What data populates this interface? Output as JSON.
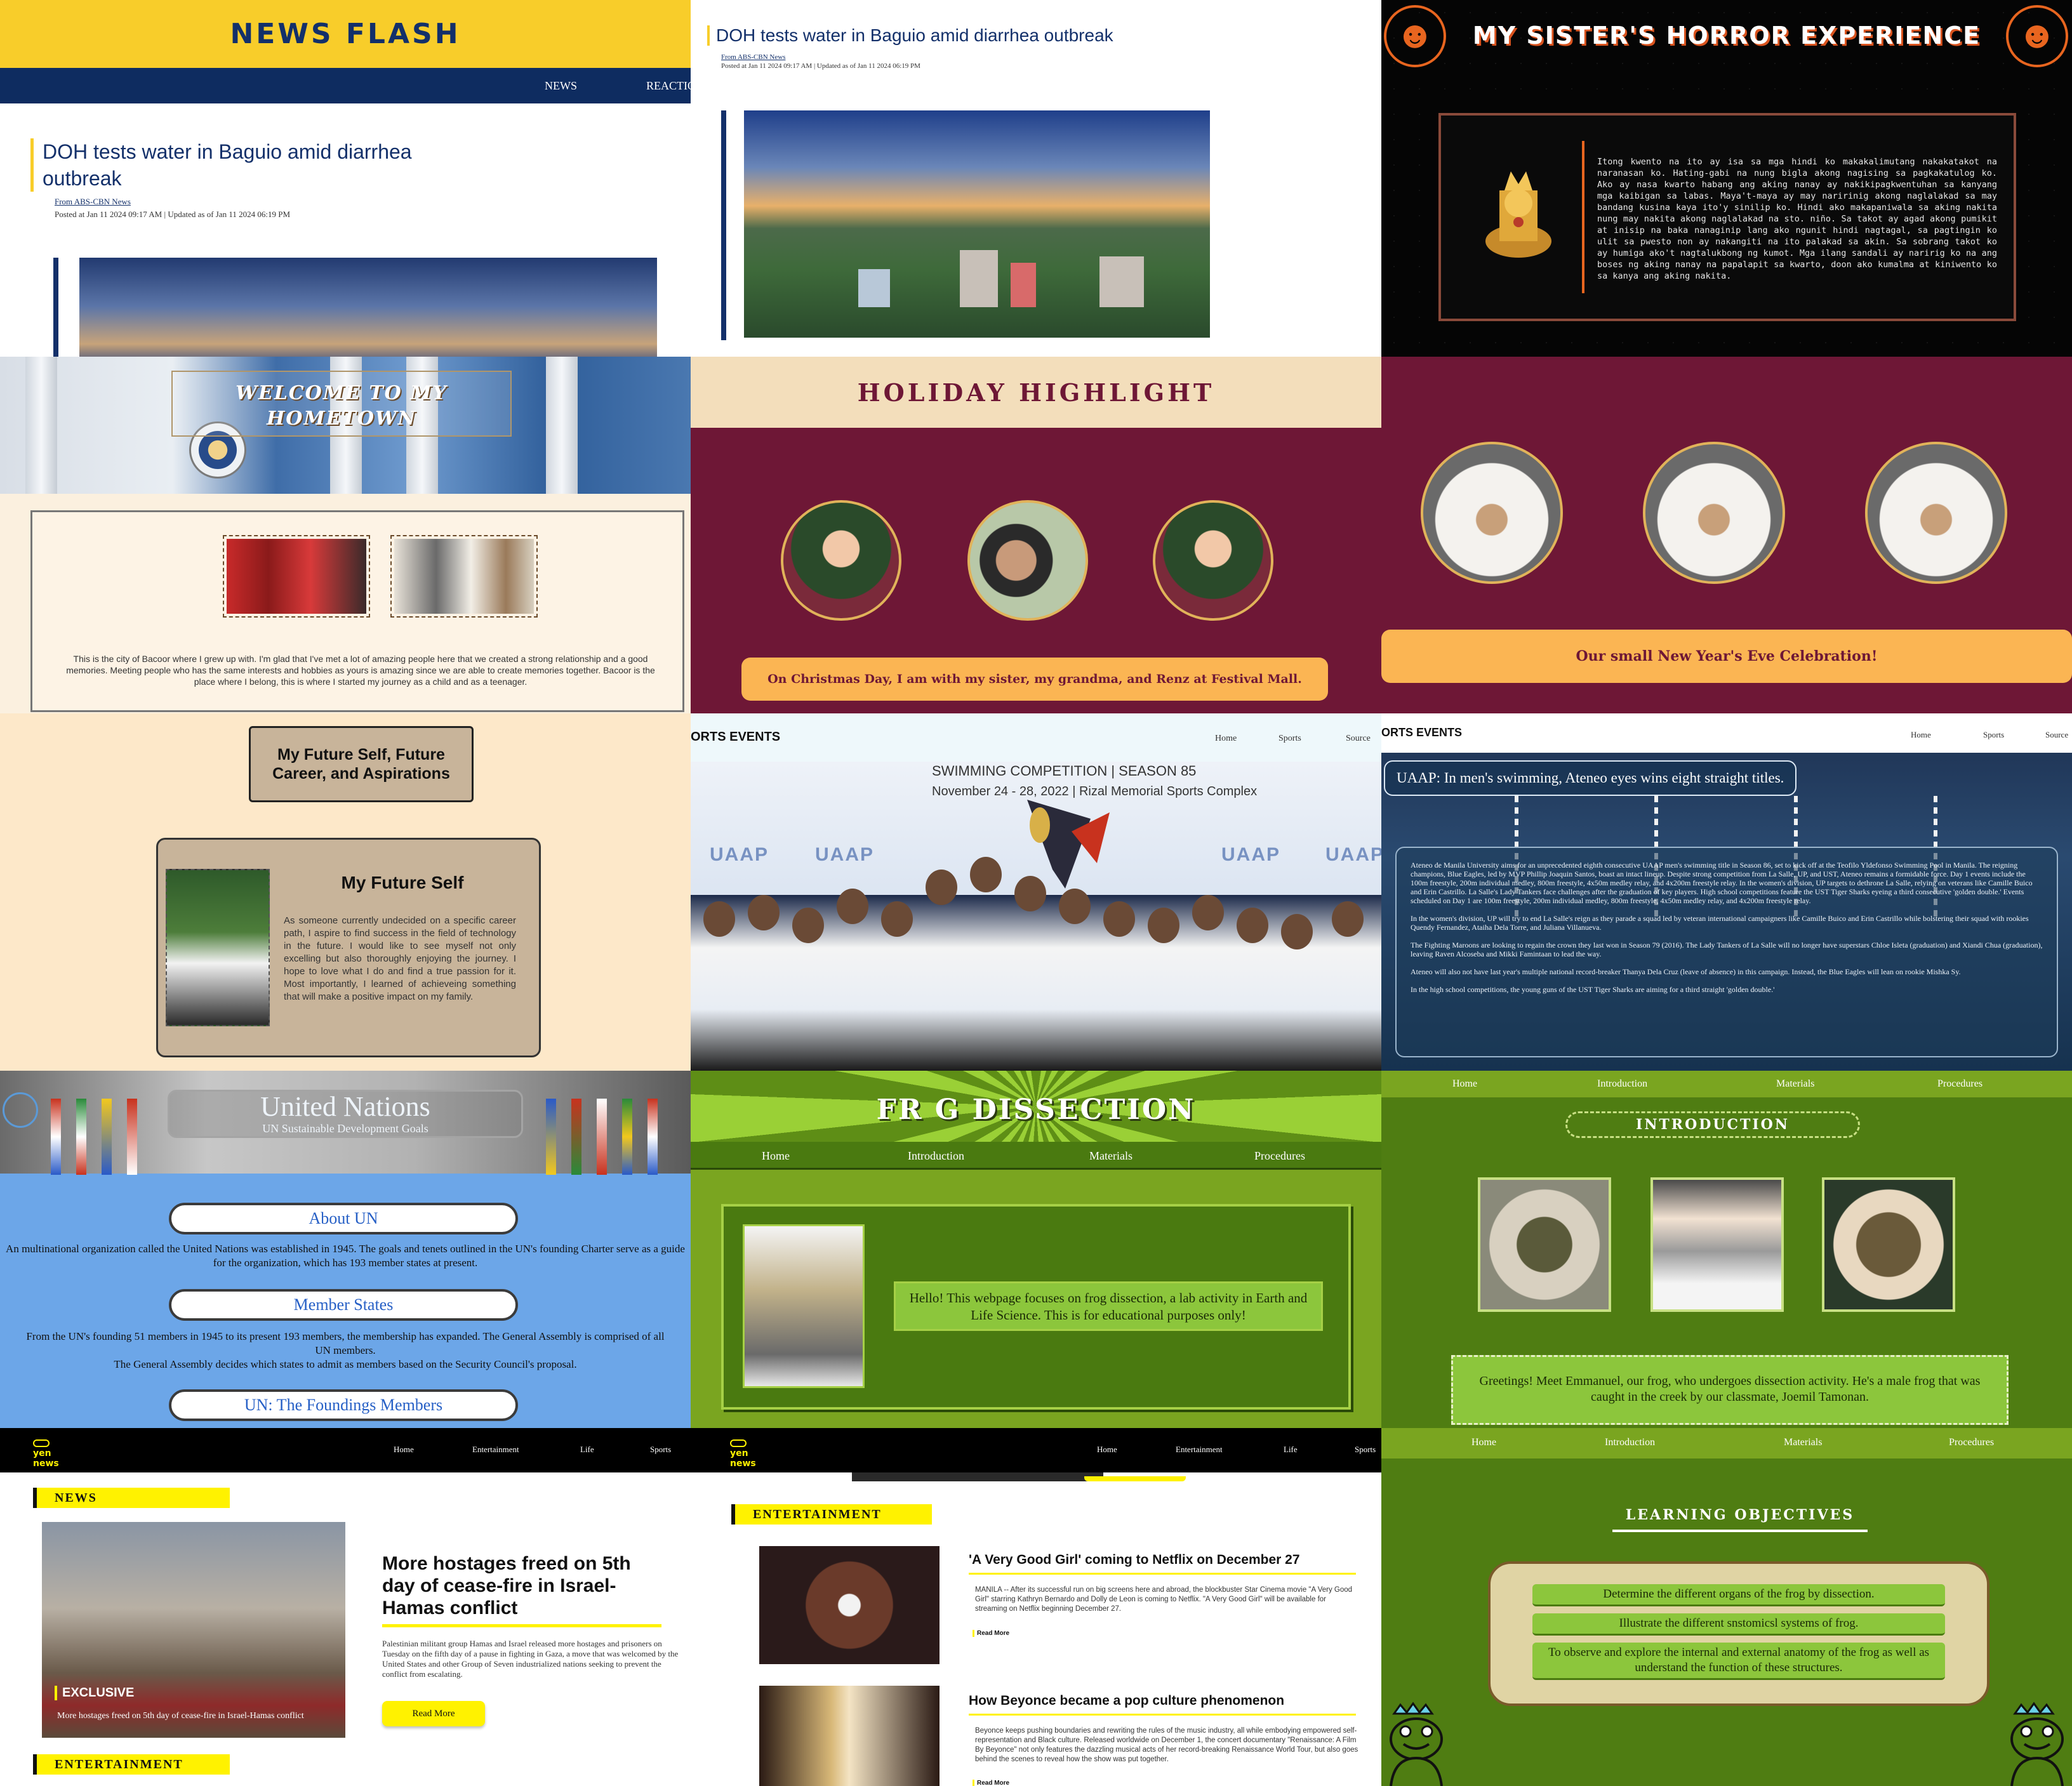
{
  "tile1": {
    "banner": "NEWS FLASH",
    "nav": [
      "NEWS",
      "REACTION"
    ],
    "headline": "DOH tests water in Baguio amid diarrhea outbreak",
    "source": "From ABS-CBN News",
    "posted": "Posted at Jan 11 2024 09:17 AM | Updated as of Jan 11 2024 06:19 PM"
  },
  "tile2": {
    "headline": "DOH tests water in Baguio amid diarrhea outbreak",
    "source": "From ABS-CBN News",
    "posted": "Posted at Jan 11 2024 09:17 AM | Updated as of Jan 11 2024 06:19 PM"
  },
  "tile3": {
    "title": "MY SISTER'S HORROR EXPERIENCE",
    "story": "Itong kwento na ito ay isa sa mga hindi ko makakalimutang nakakatakot na naranasan ko. Hating-gabi na nung bigla akong nagising sa pagkakatulog ko. Ako ay nasa kwarto habang ang aking nanay ay nakikipagkwentuhan sa kanyang mga kaibigan sa labas. Maya't-maya ay may naririnig akong naglalakad sa may bandang kusina kaya ito'y sinilip ko. Hindi ako makapaniwala sa aking nakita nung may nakita akong naglalakad na sto. niño. Sa takot ay agad akong pumikit at inisip na baka nanaginip lang ako ngunit hindi nagtagal, sa pagtingin ko ulit sa pwesto non ay nakangiti na ito palakad sa akin. Sa sobrang takot ko ay humiga ako't nagtalukbong ng kumot. Mga ilang sandali ay naririg ko na ang boses ng aking nanay na papalapit sa kwarto, doon ako kumalma at kiniwento ko sa kanya ang aking nakita."
  },
  "tile4": {
    "title": "WELCOME TO MY HOMETOWN",
    "paragraph": "This is the city of Bacoor where I grew up with. I'm glad that I've met a lot of amazing people here that we created a strong relationship and a good memories. Meeting people who has the same interests and hobbies as yours is amazing since we are able to create memories together. Bacoor is the place where I belong, this is where I started my journey as a child and as a teenager."
  },
  "tile5": {
    "title": "HOLIDAY HIGHLIGHT",
    "caption": "On Christmas Day, I am with my sister, my grandma, and Renz at Festival Mall."
  },
  "tile6": {
    "caption": "Our small New Year's Eve Celebration!"
  },
  "tile7": {
    "title": "My Future Self, Future Career, and Aspirations",
    "card_title": "My Future Self",
    "card_text": "As someone currently undecided on a specific career path, I aspire to find success in the field of technology in the future. I would like to see myself not only excelling but also thoroughly enjoying the journey. I hope to love what I do and find a true passion for it. Most importantly, I learned of achieveing something that will make a positive impact on my family."
  },
  "tile8": {
    "brand": "ORTS EVENTS",
    "nav": [
      "Home",
      "Sports",
      "Source"
    ],
    "event_title": "SWIMMING COMPETITION | SEASON 85",
    "event_sub": "November 24 - 28, 2022 | Rizal Memorial Sports Complex",
    "logo": "UAAP"
  },
  "tile9": {
    "brand": "ORTS EVENTS",
    "nav": [
      "Home",
      "Sports",
      "Source"
    ],
    "headline": "UAAP: In men's swimming, Ateneo eyes wins eight straight titles.",
    "paragraphs": [
      "Ateneo de Manila University aims for an unprecedented eighth consecutive UAAP men's swimming title in Season 86, set to kick off at the Teofilo Yldefonso Swimming Pool in Manila. The reigning champions, Blue Eagles, led by MVP Phillip Joaquin Santos, boast an intact lineup. Despite strong competition from La Salle, UP, and UST, Ateneo remains a formidable force. Day 1 events include the 100m freestyle, 200m individual medley, 800m freestyle, 4x50m medley relay, and 4x200m freestyle relay. In the women's division, UP targets to dethrone La Salle, relying on veterans like Camille Buico and Erin Castrillo. La Salle's Lady Tankers face challenges after the graduation of key players. High school competitions feature the UST Tiger Sharks eyeing a third consecutive 'golden double.' Events scheduled on Day 1 are 100m freestyle, 200m individual medley, 800m freestyle, 4x50m medley relay, and 4x200m freestyle relay.",
      "In the women's division, UP will try to end La Salle's reign as they parade a squad led by veteran international campaigners like Camille Buico and Erin Castrillo while bolstering their squad with rookies Quendy Fernandez, Ataiha Dela Torre, and Juliana Villanueva.",
      "The Fighting Maroons are looking to regain the crown they last won in Season 79 (2016). The Lady Tankers of La Salle will no longer have superstars Chloe Isleta (graduation) and Xiandi Chua (graduation), leaving Raven Alcoseba and Mikki Famintaan to lead the way.",
      "Ateneo will also not have last year's multiple national record-breaker Thanya Dela Cruz (leave of absence) in this campaign. Instead, the Blue Eagles will lean on rookie Mishka Sy.",
      "In the high school competitions, the young guns of the UST Tiger Sharks are aiming for a third straight 'golden double.'"
    ]
  },
  "tile10": {
    "title": "United Nations",
    "subtitle": "UN Sustainable Development Goals",
    "sections": [
      {
        "label": "About UN",
        "text": "An multinational organization called the United Nations was established in 1945. The goals and tenets outlined in the UN's founding Charter serve as a guide for the organization, which has 193 member states at present."
      },
      {
        "label": "Member States",
        "text": "From the UN's founding 51 members in 1945 to its present 193 members, the membership has expanded. The General Assembly is comprised of all UN members.",
        "text2": "The General Assembly decides which states to admit as members based on the Security Council's proposal."
      },
      {
        "label": "UN: The Foundings Members"
      }
    ]
  },
  "tile11": {
    "title": "FR G DISSECTION",
    "nav": [
      "Home",
      "Introduction",
      "Materials",
      "Procedures"
    ],
    "message": "Hello! This webpage focuses on frog dissection, a lab activity in Earth and Life Science. This is for educational purposes only!"
  },
  "tile12": {
    "nav": [
      "Home",
      "Introduction",
      "Materials",
      "Procedures"
    ],
    "heading": "INTRODUCTION",
    "greeting": "Greetings! Meet Emmanuel, our frog, who undergoes dissection activity. He's a male frog that was caught in the creek by our classmate, Joemil Tamonan."
  },
  "tile13": {
    "brand": "yen news",
    "nav": [
      "Home",
      "Entertainment",
      "Life",
      "Sports"
    ],
    "section1": "NEWS",
    "exclusive": "EXCLUSIVE",
    "image_caption": "More hostages freed on 5th day of cease-fire in Israel-Hamas conflict",
    "headline": "More hostages freed on 5th day of cease-fire in Israel-Hamas conflict",
    "body": "Palestinian militant group Hamas and Israel released more hostages and prisoners on Tuesday on the fifth day of a pause in fighting in Gaza, a move that was welcomed by the United States and other Group of Seven industrialized nations seeking to prevent the conflict from escalating.",
    "read_more": "Read More",
    "section2": "ENTERTAINMENT"
  },
  "tile14": {
    "brand": "yen news",
    "nav": [
      "Home",
      "Entertainment",
      "Life",
      "Sports"
    ],
    "section": "ENTERTAINMENT",
    "articles": [
      {
        "title": "'A Very Good Girl' coming to Netflix on December 27",
        "body": "MANILA -- After its successful run on big screens here and abroad, the blockbuster Star Cinema movie \"A Very Good Girl\" starring Kathryn Bernardo and Dolly de Leon is coming to Netflix. \"A Very Good Girl\" will be available for streaming on Netflix beginning December 27.",
        "more": "Read More"
      },
      {
        "title": "How Beyonce became a pop culture phenomenon",
        "body": "Beyonce keeps pushing boundaries and rewriting the rules of the music industry, all while embodying empowered self-representation and Black culture. Released worldwide on December 1, the concert documentary \"Renaissance: A Film By Beyonce\" not only features the dazzling musical acts of her record-breaking Renaissance World Tour, but also goes behind the scenes to reveal how the show was put together.",
        "more": "Read More"
      }
    ]
  },
  "tile15": {
    "nav": [
      "Home",
      "Introduction",
      "Materials",
      "Procedures"
    ],
    "heading": "LEARNING OBJECTIVES",
    "objectives": [
      "Determine the different organs of the frog by dissection.",
      "Illustrate the different snstomicsl systems of frog.",
      "To observe and explore the internal and external anatomy of the frog as well as understand the function of these structures."
    ]
  }
}
